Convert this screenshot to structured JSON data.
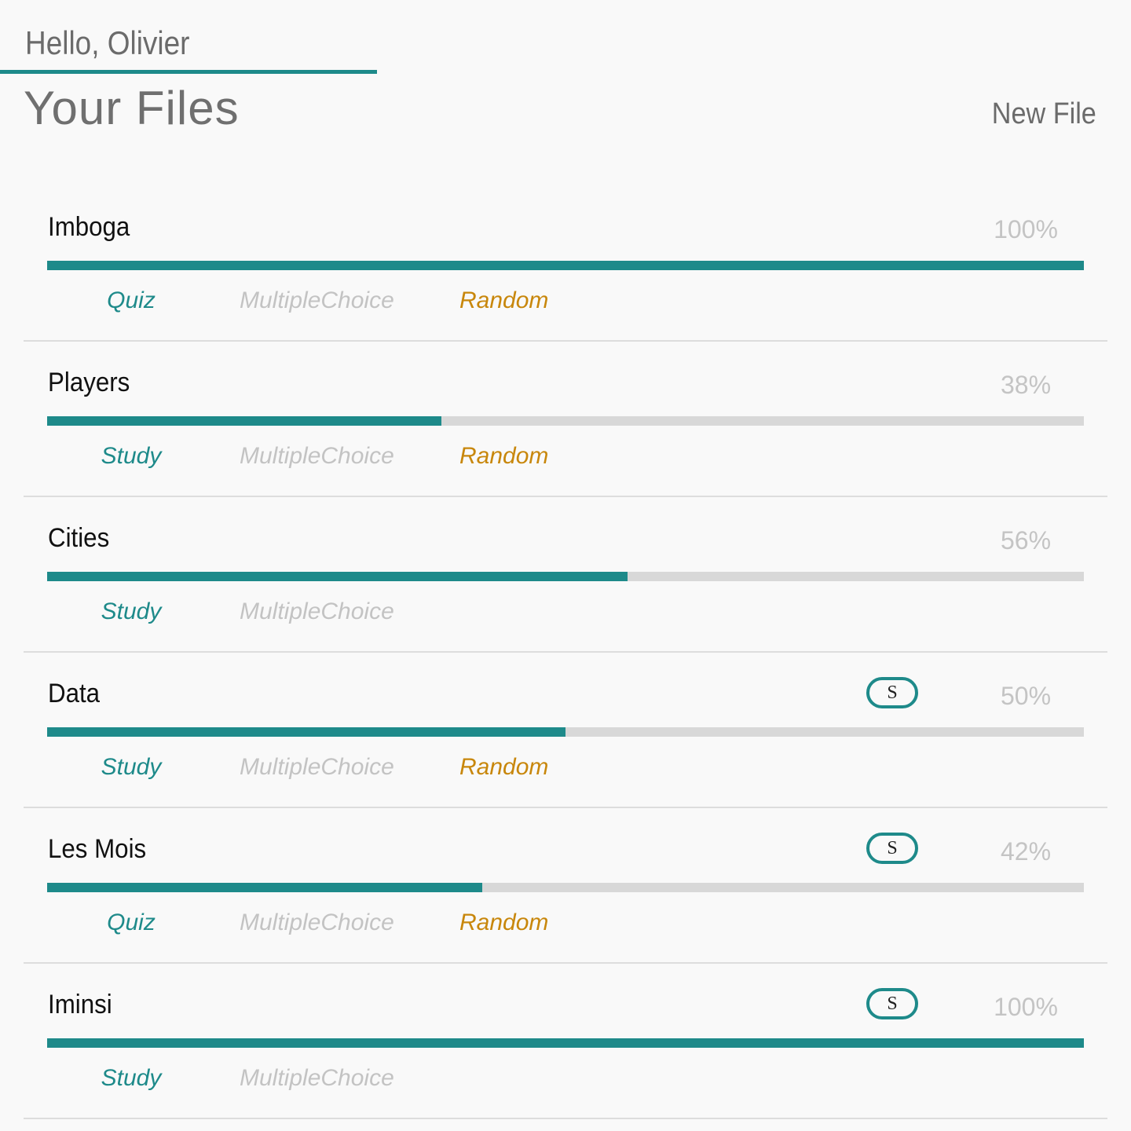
{
  "header": {
    "greeting": "Hello, Olivier",
    "title": "Your Files",
    "new_file_label": "New File"
  },
  "colors": {
    "accent": "#1e8a8a",
    "track": "#d8d8d8",
    "random": "#c8870c",
    "muted": "#c3c3c3"
  },
  "files": [
    {
      "name": "Imboga",
      "percent_label": "100%",
      "progress": 1.0,
      "badge": null,
      "mode": "Quiz",
      "type": "MultipleChoice",
      "order": "Random"
    },
    {
      "name": "Players",
      "percent_label": "38%",
      "progress": 0.38,
      "badge": null,
      "mode": "Study",
      "type": "MultipleChoice",
      "order": "Random"
    },
    {
      "name": "Cities",
      "percent_label": "56%",
      "progress": 0.56,
      "badge": null,
      "mode": "Study",
      "type": "MultipleChoice",
      "order": null
    },
    {
      "name": "Data",
      "percent_label": "50%",
      "progress": 0.5,
      "badge": "S",
      "mode": "Study",
      "type": "MultipleChoice",
      "order": "Random"
    },
    {
      "name": "Les Mois",
      "percent_label": "42%",
      "progress": 0.42,
      "badge": "S",
      "mode": "Quiz",
      "type": "MultipleChoice",
      "order": "Random"
    },
    {
      "name": "Iminsi",
      "percent_label": "100%",
      "progress": 1.0,
      "badge": "S",
      "mode": "Study",
      "type": "MultipleChoice",
      "order": null
    }
  ]
}
